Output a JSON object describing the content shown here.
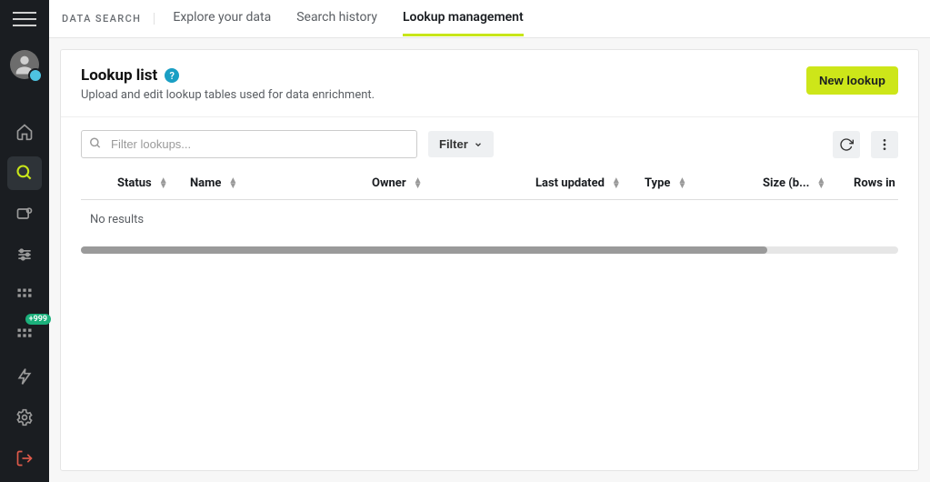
{
  "breadcrumb": "DATA SEARCH",
  "tabs": [
    {
      "label": "Explore your data",
      "active": false
    },
    {
      "label": "Search history",
      "active": false
    },
    {
      "label": "Lookup management",
      "active": true
    }
  ],
  "page": {
    "title": "Lookup list",
    "subtitle": "Upload and edit lookup tables used for data enrichment."
  },
  "buttons": {
    "new_lookup": "New lookup",
    "filter": "Filter"
  },
  "search": {
    "placeholder": "Filter lookups..."
  },
  "columns": {
    "status": "Status",
    "name": "Name",
    "owner": "Owner",
    "last_updated": "Last updated",
    "type": "Type",
    "size": "Size (b...",
    "rows": "Rows in lo"
  },
  "table": {
    "empty": "No results"
  },
  "sidebar": {
    "badge": "+999"
  }
}
